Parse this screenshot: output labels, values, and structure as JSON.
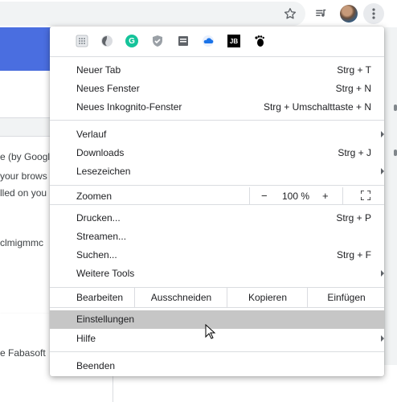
{
  "toolbar": {
    "icons": [
      "star-icon",
      "media-control-icon",
      "profile-avatar",
      "more-vert-icon"
    ]
  },
  "background_page": {
    "text_lines": [
      "e (by Googl",
      "your brows",
      "lled on you",
      "clmigmmc",
      "e Fabasoft"
    ]
  },
  "menu": {
    "extensions": [
      "extension-grid-icon",
      "extension-circle-icon",
      "grammarly-icon",
      "shield-check-icon",
      "bookmark-box-icon",
      "cloud-icon",
      "jetbrains-icon",
      "gnome-foot-icon"
    ],
    "extension_labels": {
      "grammarly": "G",
      "jetbrains": "JB"
    },
    "group1": [
      {
        "label": "Neuer Tab",
        "shortcut": "Strg + T"
      },
      {
        "label": "Neues Fenster",
        "shortcut": "Strg + N"
      },
      {
        "label": "Neues Inkognito-Fenster",
        "shortcut": "Strg + Umschalttaste + N"
      }
    ],
    "group2": [
      {
        "label": "Verlauf",
        "shortcut": ""
      },
      {
        "label": "Downloads",
        "shortcut": "Strg + J"
      },
      {
        "label": "Lesezeichen",
        "shortcut": ""
      }
    ],
    "zoom": {
      "label": "Zoomen",
      "minus": "−",
      "value": "100 %",
      "plus": "+"
    },
    "group3": [
      {
        "label": "Drucken...",
        "shortcut": "Strg + P"
      },
      {
        "label": "Streamen...",
        "shortcut": ""
      },
      {
        "label": "Suchen...",
        "shortcut": "Strg + F"
      },
      {
        "label": "Weitere Tools",
        "shortcut": ""
      }
    ],
    "edit": {
      "label": "Bearbeiten",
      "cut": "Ausschneiden",
      "copy": "Kopieren",
      "paste": "Einfügen"
    },
    "group4": [
      {
        "label": "Einstellungen",
        "shortcut": ""
      },
      {
        "label": "Hilfe",
        "shortcut": ""
      }
    ],
    "quit": {
      "label": "Beenden"
    }
  },
  "colors": {
    "highlight": "#c6c6c6",
    "divider": "#dadce0",
    "banner": "#4a6ee0",
    "grammarly": "#15c39a"
  }
}
